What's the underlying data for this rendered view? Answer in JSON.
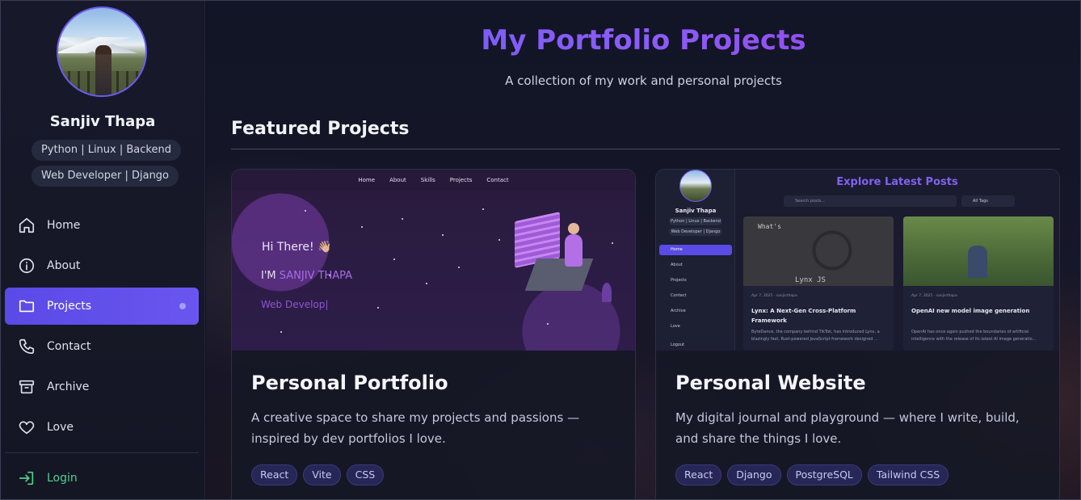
{
  "sidebar": {
    "profile_name": "Sanjiv Thapa",
    "chips": [
      "Python | Linux | Backend",
      "Web Developer | Django"
    ],
    "nav": [
      {
        "label": "Home",
        "icon": "home-icon",
        "active": false
      },
      {
        "label": "About",
        "icon": "info-icon",
        "active": false
      },
      {
        "label": "Projects",
        "icon": "folder-icon",
        "active": true
      },
      {
        "label": "Contact",
        "icon": "phone-icon",
        "active": false
      },
      {
        "label": "Archive",
        "icon": "archive-icon",
        "active": false
      },
      {
        "label": "Love",
        "icon": "heart-icon",
        "active": false
      }
    ],
    "login_label": "Login"
  },
  "main": {
    "title": "My Portfolio Projects",
    "subtitle": "A collection of my work and personal projects",
    "section_title": "Featured Projects",
    "projects": [
      {
        "title": "Personal Portfolio",
        "description": "A creative space to share my projects and passions — inspired by dev portfolios I love.",
        "tags": [
          "React",
          "Vite",
          "CSS"
        ],
        "preview": {
          "nav": [
            "Home",
            "About",
            "Skills",
            "Projects",
            "Contact"
          ],
          "greeting": "Hi There! 👋🏼",
          "im_prefix": "I'M ",
          "im_name": "SANJIV THAPA",
          "typing": "Web Develop|"
        }
      },
      {
        "title": "Personal Website",
        "description": "My digital journal and playground — where I write, build, and share the things I love.",
        "tags": [
          "React",
          "Django",
          "PostgreSQL",
          "Tailwind CSS"
        ],
        "preview": {
          "name": "Sanjiv Thapa",
          "chips": [
            "Python | Linux | Backend",
            "Web Developer | Django"
          ],
          "nav": [
            "Home",
            "About",
            "Projects",
            "Contact",
            "Archive",
            "Love",
            "Logout"
          ],
          "heading": "Explore Latest Posts",
          "search_placeholder": "Search posts...",
          "tags_filter": "All Tags",
          "posts": [
            {
              "meta": "Apr 7, 2025 · sanjivthapa",
              "title": "Lynx: A Next-Gen Cross-Platform Framework",
              "desc": "ByteDance, the company behind TikTok, has introduced Lynx, a blazingly fast, Rust-powered JavaScript framework designed ..."
            },
            {
              "meta": "Apr 7, 2025 · sanjivthapa",
              "title": "OpenAI new model image generation",
              "desc": "OpenAI has once again pushed the boundaries of artificial intelligence with the release of its latest AI image generatio..."
            }
          ]
        }
      }
    ]
  },
  "colors": {
    "accent": "#5a4ae6",
    "title_gradient_start": "#6d5cf6",
    "title_gradient_end": "#9b3bea",
    "login": "#52d08b",
    "tag_bg": "#262657"
  }
}
